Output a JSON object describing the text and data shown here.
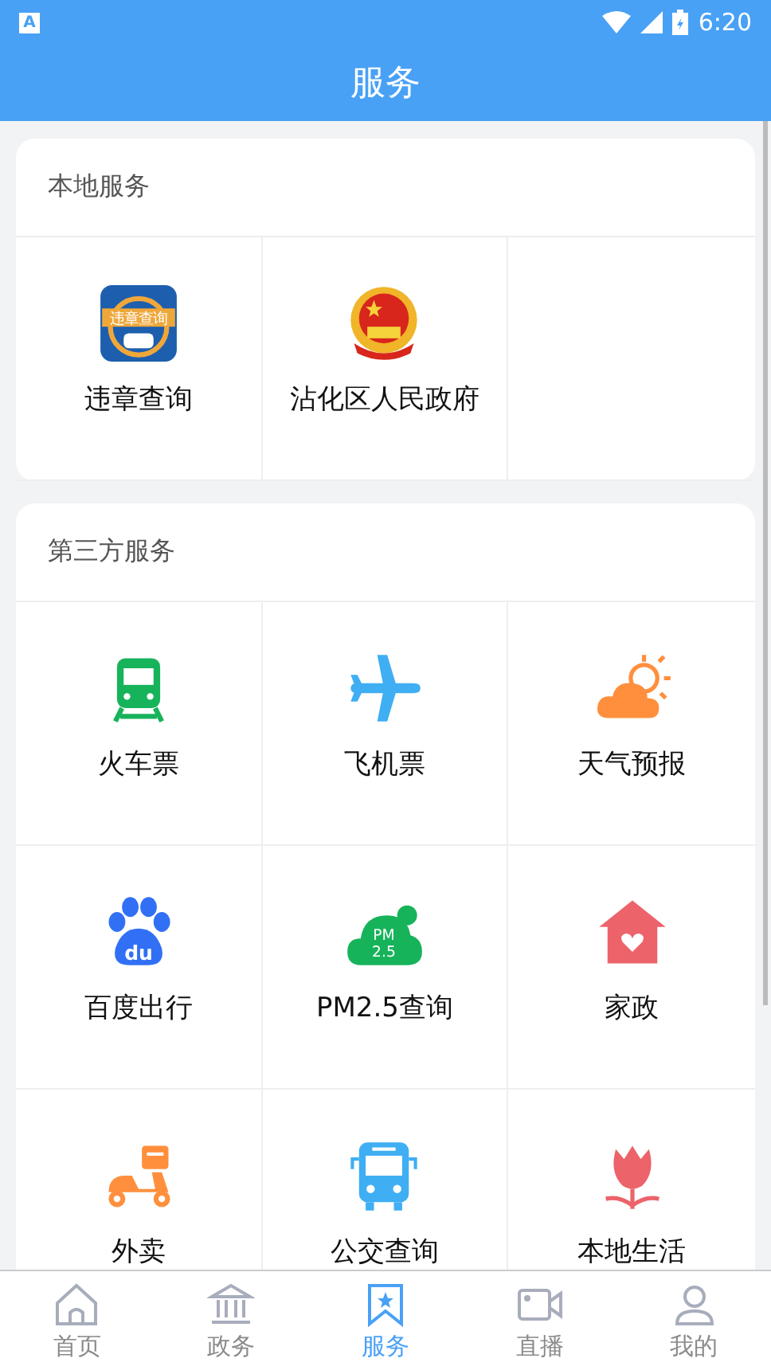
{
  "status_bar": {
    "time": "6:20",
    "notification_badge": "A"
  },
  "header": {
    "title": "服务"
  },
  "sections": [
    {
      "title": "本地服务",
      "items": [
        {
          "label": "违章查询",
          "icon_text": [
            "违章查询"
          ]
        },
        {
          "label": "沾化区人民政府"
        }
      ]
    },
    {
      "title": "第三方服务",
      "items": [
        {
          "label": "火车票"
        },
        {
          "label": "飞机票"
        },
        {
          "label": "天气预报"
        },
        {
          "label": "百度出行",
          "icon_text": [
            "du"
          ]
        },
        {
          "label": "PM2.5查询",
          "icon_text": [
            "PM",
            "2.5"
          ]
        },
        {
          "label": "家政"
        },
        {
          "label": "外卖"
        },
        {
          "label": "公交查询"
        },
        {
          "label": "本地生活"
        }
      ]
    }
  ],
  "tab_bar": [
    {
      "label": "首页",
      "selected": false
    },
    {
      "label": "政务",
      "selected": false
    },
    {
      "label": "服务",
      "selected": true
    },
    {
      "label": "直播",
      "selected": false
    },
    {
      "label": "我的",
      "selected": false
    }
  ]
}
